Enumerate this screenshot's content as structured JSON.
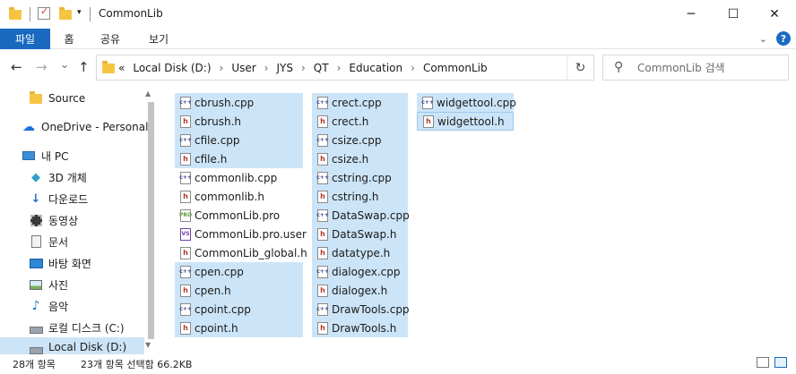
{
  "window": {
    "title": "CommonLib",
    "minimize_glyph": "─",
    "maximize_glyph": "☐",
    "close_glyph": "✕"
  },
  "ribbon": {
    "tabs": [
      "파일",
      "홈",
      "공유",
      "보기"
    ]
  },
  "nav": {
    "back": "←",
    "forward": "→",
    "recent": "⌄",
    "up": "↑"
  },
  "address": {
    "chevron": "«",
    "crumbs": [
      "Local Disk (D:)",
      "User",
      "JYS",
      "QT",
      "Education",
      "CommonLib"
    ],
    "separator": "›",
    "refresh": "↻"
  },
  "search": {
    "placeholder": "CommonLib 검색"
  },
  "sidebar": {
    "items": [
      {
        "label": "Source",
        "icon": "folder-icon"
      },
      {
        "label": "OneDrive - Personal",
        "icon": "onedrive-icon"
      },
      {
        "label": "내 PC",
        "icon": "pc-icon"
      },
      {
        "label": "3D 개체",
        "icon": "3d-objects-icon"
      },
      {
        "label": "다운로드",
        "icon": "downloads-icon"
      },
      {
        "label": "동영상",
        "icon": "videos-icon"
      },
      {
        "label": "문서",
        "icon": "documents-icon"
      },
      {
        "label": "바탕 화면",
        "icon": "desktop-icon"
      },
      {
        "label": "사진",
        "icon": "pictures-icon"
      },
      {
        "label": "음악",
        "icon": "music-icon"
      },
      {
        "label": "로컬 디스크 (C:)",
        "icon": "drive-icon"
      },
      {
        "label": "Local Disk (D:)",
        "icon": "drive-icon"
      }
    ]
  },
  "files": {
    "col1": [
      {
        "name": "cbrush.cpp",
        "type": "cpp",
        "selected": true
      },
      {
        "name": "cbrush.h",
        "type": "h",
        "selected": true
      },
      {
        "name": "cfile.cpp",
        "type": "cpp",
        "selected": true
      },
      {
        "name": "cfile.h",
        "type": "h",
        "selected": true
      },
      {
        "name": "commonlib.cpp",
        "type": "cpp",
        "selected": false
      },
      {
        "name": "commonlib.h",
        "type": "h",
        "selected": false
      },
      {
        "name": "CommonLib.pro",
        "type": "pro",
        "selected": false
      },
      {
        "name": "CommonLib.pro.user",
        "type": "user",
        "selected": false
      },
      {
        "name": "CommonLib_global.h",
        "type": "h",
        "selected": false
      },
      {
        "name": "cpen.cpp",
        "type": "cpp",
        "selected": true
      },
      {
        "name": "cpen.h",
        "type": "h",
        "selected": true
      },
      {
        "name": "cpoint.cpp",
        "type": "cpp",
        "selected": true
      },
      {
        "name": "cpoint.h",
        "type": "h",
        "selected": true
      }
    ],
    "col2": [
      {
        "name": "crect.cpp",
        "type": "cpp",
        "selected": true
      },
      {
        "name": "crect.h",
        "type": "h",
        "selected": true
      },
      {
        "name": "csize.cpp",
        "type": "cpp",
        "selected": true
      },
      {
        "name": "csize.h",
        "type": "h",
        "selected": true
      },
      {
        "name": "cstring.cpp",
        "type": "cpp",
        "selected": true
      },
      {
        "name": "cstring.h",
        "type": "h",
        "selected": true
      },
      {
        "name": "DataSwap.cpp",
        "type": "cpp",
        "selected": true
      },
      {
        "name": "DataSwap.h",
        "type": "h",
        "selected": true
      },
      {
        "name": "datatype.h",
        "type": "h",
        "selected": true
      },
      {
        "name": "dialogex.cpp",
        "type": "cpp",
        "selected": true
      },
      {
        "name": "dialogex.h",
        "type": "h",
        "selected": true
      },
      {
        "name": "DrawTools.cpp",
        "type": "cpp",
        "selected": true
      },
      {
        "name": "DrawTools.h",
        "type": "h",
        "selected": true
      }
    ],
    "col3": [
      {
        "name": "widgettool.cpp",
        "type": "cpp",
        "selected": true
      },
      {
        "name": "widgettool.h",
        "type": "h",
        "selected": true,
        "focused": true
      }
    ]
  },
  "status": {
    "item_count": "28개 항목",
    "selection": "23개 항목 선택함 66.2KB"
  },
  "colors": {
    "accent": "#1969c0",
    "selection": "#cce4f7",
    "focus_border": "#99c9ef"
  }
}
